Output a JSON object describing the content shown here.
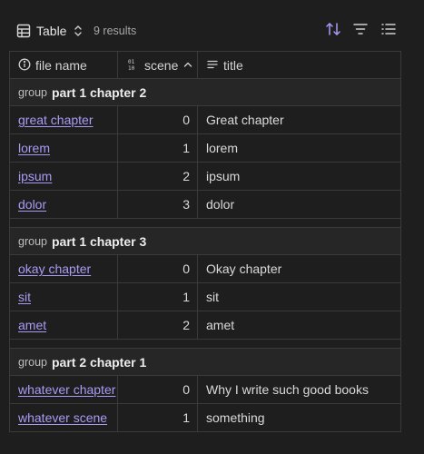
{
  "toolbar": {
    "view_label": "Table",
    "results": "9 results",
    "icons": {
      "view": "table-icon",
      "view_dropdown": "chevron-up-down-icon",
      "sort": "sort-arrows-icon",
      "filter": "filter-icon",
      "properties": "list-icon"
    },
    "accent": "#a99bf5"
  },
  "columns": [
    {
      "label": "file name",
      "icon": "info-icon"
    },
    {
      "label": "scene",
      "icon": "number-icon",
      "sort": "ascending"
    },
    {
      "label": "title",
      "icon": "text-lines-icon"
    }
  ],
  "groups": [
    {
      "prefix": "group",
      "name": "part 1 chapter 2",
      "rows": [
        {
          "file": "great chapter",
          "scene": "0",
          "title": "Great chapter"
        },
        {
          "file": "lorem",
          "scene": "1",
          "title": "lorem"
        },
        {
          "file": "ipsum",
          "scene": "2",
          "title": "ipsum"
        },
        {
          "file": "dolor",
          "scene": "3",
          "title": "dolor"
        }
      ]
    },
    {
      "prefix": "group",
      "name": "part 1 chapter 3",
      "rows": [
        {
          "file": "okay chapter",
          "scene": "0",
          "title": "Okay chapter"
        },
        {
          "file": "sit",
          "scene": "1",
          "title": "sit"
        },
        {
          "file": "amet",
          "scene": "2",
          "title": "amet"
        }
      ]
    },
    {
      "prefix": "group",
      "name": "part 2 chapter 1",
      "rows": [
        {
          "file": "whatever chapter",
          "scene": "0",
          "title": "Why I write such good books"
        },
        {
          "file": "whatever scene",
          "scene": "1",
          "title": "something"
        }
      ]
    }
  ]
}
